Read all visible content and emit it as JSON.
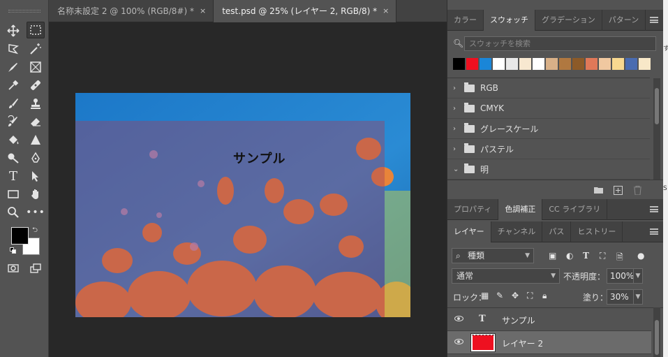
{
  "document_tabs": [
    {
      "title": "名称未設定 2 @ 100% (RGB/8#) *",
      "active": false,
      "close": "×"
    },
    {
      "title": "test.psd @ 25% (レイヤー 2, RGB/8) *",
      "active": true,
      "close": "×"
    }
  ],
  "canvas": {
    "text_layer_content": "サンプル"
  },
  "toolbar": {
    "tools": [
      "move-icon",
      "marquee-icon",
      "lasso-icon",
      "magic-wand-icon",
      "pen-icon",
      "frame-icon",
      "eyedropper-icon",
      "healing-icon",
      "brush-icon",
      "stamp-icon",
      "history-brush-icon",
      "eraser-icon",
      "paint-bucket-icon",
      "sharpen-icon",
      "dodge-icon",
      "path-pen-icon",
      "type-icon",
      "path-select-icon",
      "rectangle-icon",
      "hand-icon",
      "zoom-icon",
      "more-tools-icon",
      "quick-mask-icon",
      "screen-mode-icon"
    ],
    "foreground_color": "#000000",
    "background_color": "#ffffff"
  },
  "swatches_panel": {
    "tabs": [
      "カラー",
      "スウォッチ",
      "グラデーション",
      "パターン"
    ],
    "active_tab": "スウォッチ",
    "search_placeholder": "スウォッチを検索",
    "recent_colors": [
      "#000000",
      "#ee1020",
      "#1a86d8",
      "#ffffff",
      "#e8e8e8",
      "#f8e8d0",
      "#ffffff",
      "#d8b088",
      "#b07840",
      "#8c5a28",
      "#e07858",
      "#f0c8a0",
      "#f8d890",
      "#4a6cb0",
      "#f8e8c8"
    ],
    "groups": [
      {
        "chevron": "›",
        "name": "RGB"
      },
      {
        "chevron": "›",
        "name": "CMYK"
      },
      {
        "chevron": "›",
        "name": "グレースケール"
      },
      {
        "chevron": "›",
        "name": "パステル"
      },
      {
        "chevron": "⌄",
        "name": "明"
      }
    ]
  },
  "properties_panel": {
    "tabs": [
      "プロパティ",
      "色調補正",
      "CC ライブラリ"
    ],
    "active_tab": "色調補正"
  },
  "layers_panel": {
    "tabs": [
      "レイヤー",
      "チャンネル",
      "パス",
      "ヒストリー"
    ],
    "active_tab": "レイヤー",
    "filter_kind": "種類",
    "blend_mode": "通常",
    "opacity_label": "不透明度：",
    "opacity_value": "100%",
    "lock_label": "ロック：",
    "fill_label": "塗り：",
    "fill_value": "30%",
    "layers": [
      {
        "name": "サンプル",
        "type": "text",
        "type_glyph": "T",
        "visible": true,
        "selected": false
      },
      {
        "name": "レイヤー 2",
        "type": "pixel",
        "visible": true,
        "selected": true,
        "thumb_color": "#ee1020"
      }
    ]
  },
  "edge_text": [
    "す",
    "S"
  ]
}
